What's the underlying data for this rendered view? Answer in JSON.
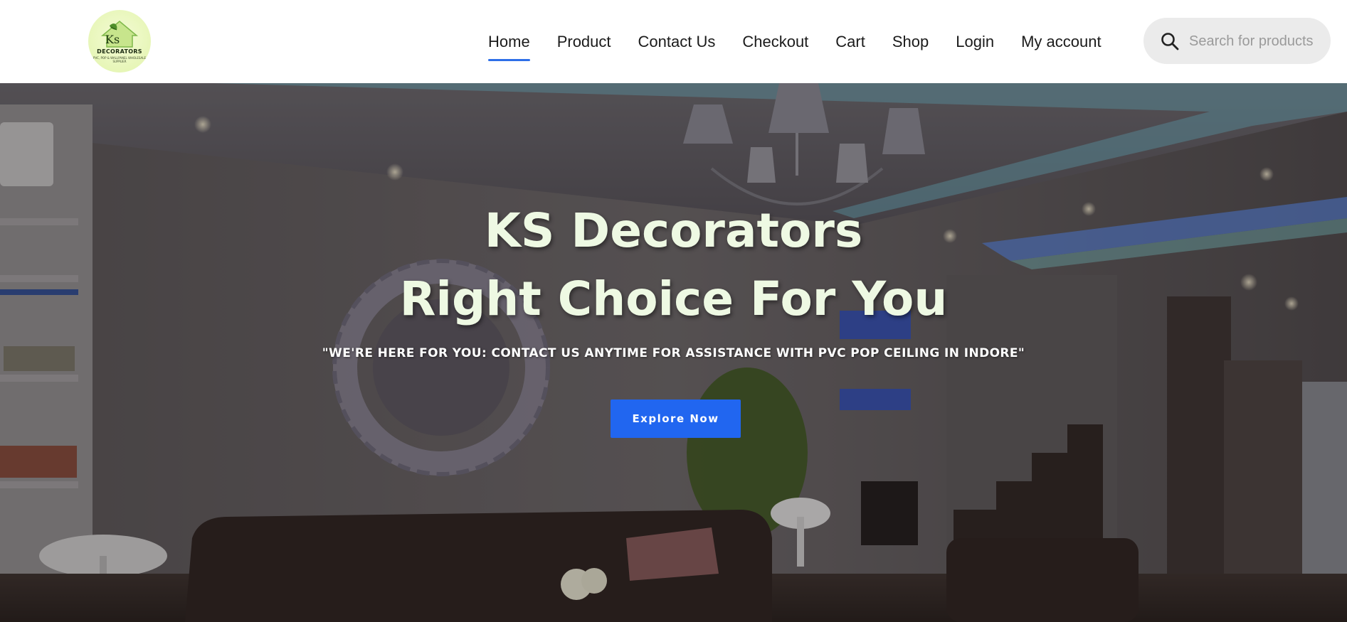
{
  "brand": {
    "logo_name": "DECORATORS",
    "logo_initials": "Ks",
    "logo_tagline": "PVC, POP & WALLPANEL WHOLESALE SUPPLIER"
  },
  "nav": {
    "items": [
      {
        "label": "Home",
        "active": true
      },
      {
        "label": "Product"
      },
      {
        "label": "Contact Us"
      },
      {
        "label": "Checkout"
      },
      {
        "label": "Cart"
      },
      {
        "label": "Shop"
      },
      {
        "label": "Login"
      },
      {
        "label": "My account"
      }
    ]
  },
  "search": {
    "placeholder": "Search for products",
    "icon": "search-icon"
  },
  "hero": {
    "title_line1": "KS Decorators",
    "title_line2": "Right Choice For You",
    "subtitle": "\"WE'RE HERE FOR YOU: CONTACT US ANYTIME FOR ASSISTANCE WITH PVC POP CEILING IN INDORE\"",
    "cta_label": "Explore Now"
  },
  "colors": {
    "accent": "#2166f0",
    "title_text": "#eef9e3",
    "nav_underline": "#2d6fe8"
  }
}
